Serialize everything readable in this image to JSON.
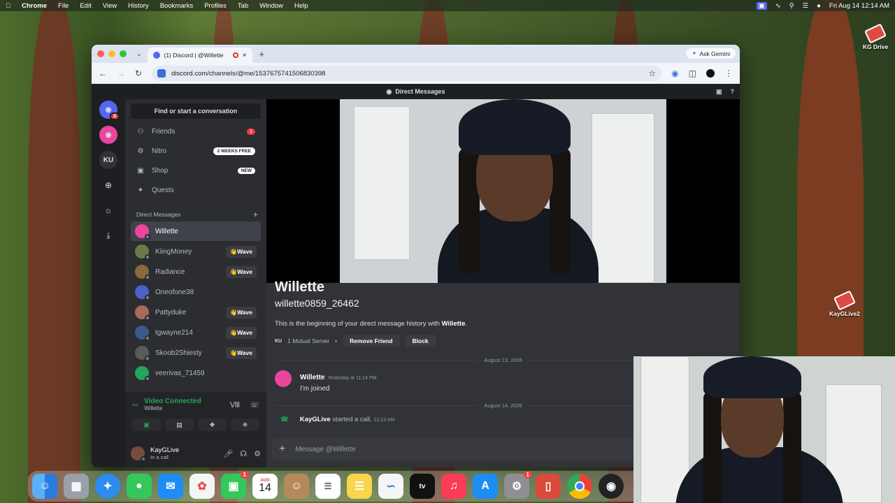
{
  "menubar": {
    "app": "Chrome",
    "items": [
      "File",
      "Edit",
      "View",
      "History",
      "Bookmarks",
      "Profiles",
      "Tab",
      "Window",
      "Help"
    ],
    "datetime": "Fri Aug 14  12:14 AM"
  },
  "desktop_icons": [
    {
      "label": "KG Drive"
    },
    {
      "label": "KayGLive2"
    }
  ],
  "browser": {
    "tab_title": "(1) Discord | @Willette",
    "url": "discord.com/channels/@me/1537675741506830398",
    "ask_gemini": "Ask Gemini"
  },
  "discord": {
    "top_title": "Direct Messages",
    "servers": [
      {
        "label": "",
        "badge": "2"
      },
      {
        "label": "",
        "badge": ""
      },
      {
        "label": "KU",
        "badge": ""
      }
    ],
    "find_label": "Find or start a conversation",
    "nav": [
      {
        "label": "Friends",
        "count": "1"
      },
      {
        "label": "Nitro",
        "pill": "2 WEEKS FREE"
      },
      {
        "label": "Shop",
        "pill": "NEW"
      },
      {
        "label": "Quests"
      }
    ],
    "dm_header": "Direct Messages",
    "wave_label": "👋Wave",
    "dms": [
      {
        "name": "Willette",
        "color": "#eb459e",
        "wave": false
      },
      {
        "name": "KiingMoney",
        "color": "#6b7a4a",
        "wave": true
      },
      {
        "name": "Radiance",
        "color": "#8a6a3a",
        "wave": true
      },
      {
        "name": "Oneofone38",
        "color": "#4a62c8",
        "wave": false
      },
      {
        "name": "Pattyduke",
        "color": "#a86a5a",
        "wave": true
      },
      {
        "name": "tgwayne214",
        "color": "#3a5a8a",
        "wave": true
      },
      {
        "name": "Skoob2Shiesty",
        "color": "#5a5a5a",
        "wave": true
      },
      {
        "name": "veerivas_71459",
        "color": "#23a55a",
        "wave": false
      }
    ],
    "voice": {
      "status": "Video Connected",
      "channel": "Willette"
    },
    "user": {
      "name": "KayGLive",
      "status": "In a call"
    },
    "chat": {
      "big_name": "Willette",
      "handle": "willette0859_26462",
      "intro_prefix": "This is the beginning of your direct message history with ",
      "intro_name": "Willette",
      "intro_suffix": ".",
      "mutual_tag": "KU",
      "mutual": "1 Mutual Server",
      "remove_friend": "Remove Friend",
      "block": "Block",
      "date1": "August 13, 2026",
      "msg_author": "Willette",
      "msg_time": "Yesterday at 11:14 PM",
      "msg_text": "I'm joined",
      "date2": "August 14, 2026",
      "call_user": "KayGLive",
      "call_text": " started a call.",
      "call_time": "12:13 AM",
      "placeholder": "Message @Willette"
    }
  },
  "dock": {
    "calendar_month": "AUG",
    "calendar_day": "14",
    "facetime_badge": "1",
    "settings_badge": "1",
    "apps": [
      "finder-icon",
      "launchpad-icon",
      "safari-icon",
      "messages-icon",
      "mail-icon",
      "photos-icon",
      "facetime-icon",
      "calendar-icon",
      "contacts-icon",
      "reminders-icon",
      "notes-icon",
      "freeform-icon",
      "tv-icon",
      "music-icon",
      "app-store-icon",
      "system-settings-icon",
      "iphone-mirroring-icon",
      "chrome-icon",
      "obs-icon"
    ]
  }
}
